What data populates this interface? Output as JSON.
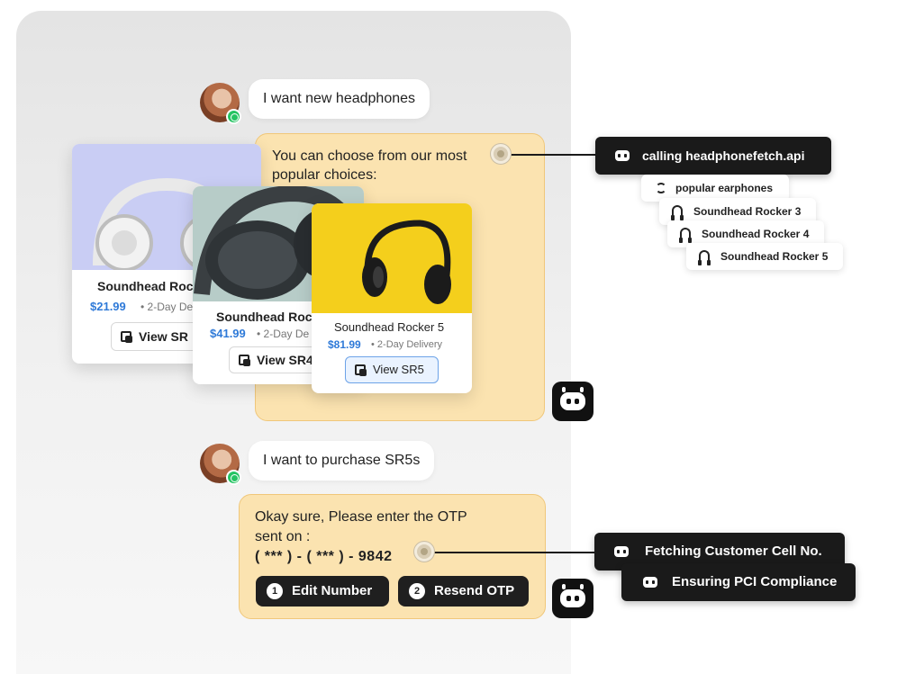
{
  "chat": {
    "msg1": "I want new headphones",
    "bot1": "You can choose from our most popular choices:",
    "msg2": "I want to purchase SR5s",
    "bot2_line1": "Okay sure, Please enter the OTP",
    "bot2_line2": "sent on :",
    "bot2_phone": "( *** ) - ( *** ) - 9842"
  },
  "products": [
    {
      "name": "Soundhead Rocker 3",
      "visible_name": "Soundhead Roc",
      "price": "$21.99",
      "delivery": "2-Day Delivery",
      "visible_delivery": "2-Day Deli",
      "button": "View SR3",
      "visible_button": "View SR"
    },
    {
      "name": "Soundhead Rocker 4",
      "visible_name": "Soundhead Rock",
      "price": "$41.99",
      "delivery": "2-Day Delivery",
      "visible_delivery": "2-Day De",
      "button": "View SR4",
      "visible_button": "View SR4"
    },
    {
      "name": "Soundhead Rocker 5",
      "price": "$81.99",
      "delivery": "2-Day Delivery",
      "button": "View SR5"
    }
  ],
  "api_trace": {
    "call": "calling headphonefetch.api",
    "items": [
      "popular earphones",
      "Soundhead Rocker 3",
      "Soundhead Rocker 4",
      "Soundhead Rocker 5"
    ]
  },
  "otp": {
    "edit_number": "Edit Number",
    "resend_otp": "Resend OTP",
    "step1": "1",
    "step2": "2"
  },
  "status_tags": [
    "Fetching Customer Cell No.",
    "Ensuring PCI Compliance"
  ],
  "colors": {
    "bot_bubble": "#fbe3b0",
    "bot_border": "#f0c77a",
    "price_blue": "#2f7ad8",
    "whatsapp_green": "#25c463",
    "dark": "#1a1a1a"
  },
  "icons": [
    "whatsapp-icon",
    "bot-icon",
    "headphones-icon",
    "sync-icon",
    "view-product-icon"
  ]
}
